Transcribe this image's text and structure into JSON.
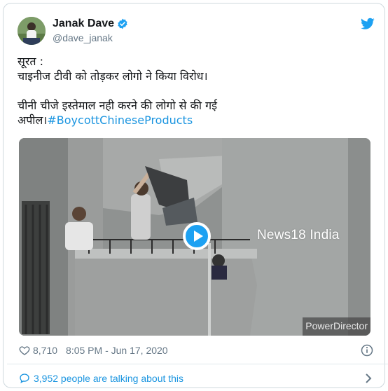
{
  "author": {
    "display_name": "Janak Dave",
    "handle": "@dave_janak",
    "verified": true
  },
  "tweet": {
    "line1": "सूरत :",
    "line2": "चाइनीज टीवी को तोड़कर लोगो ने किया विरोध।",
    "line3": "चीनी चीजे इस्तेमाल नही करने की लोगो से की गई",
    "line4_prefix": "अपील।",
    "hashtag": "#BoycottChineseProducts"
  },
  "media": {
    "watermark": "News18 India",
    "corner_badge": "PowerDirector"
  },
  "meta": {
    "likes": "8,710",
    "timestamp": "8:05 PM - Jun 17, 2020"
  },
  "footer": {
    "talking_text": "3,952 people are talking about this"
  },
  "colors": {
    "accent": "#1da1f2",
    "link": "#1b95e0",
    "secondary_text": "#657786",
    "border": "#cfd9de"
  },
  "icons": [
    "avatar",
    "verified-badge-icon",
    "twitter-logo-icon",
    "play-icon",
    "heart-icon",
    "info-icon",
    "speech-bubble-icon",
    "chevron-right-icon"
  ]
}
